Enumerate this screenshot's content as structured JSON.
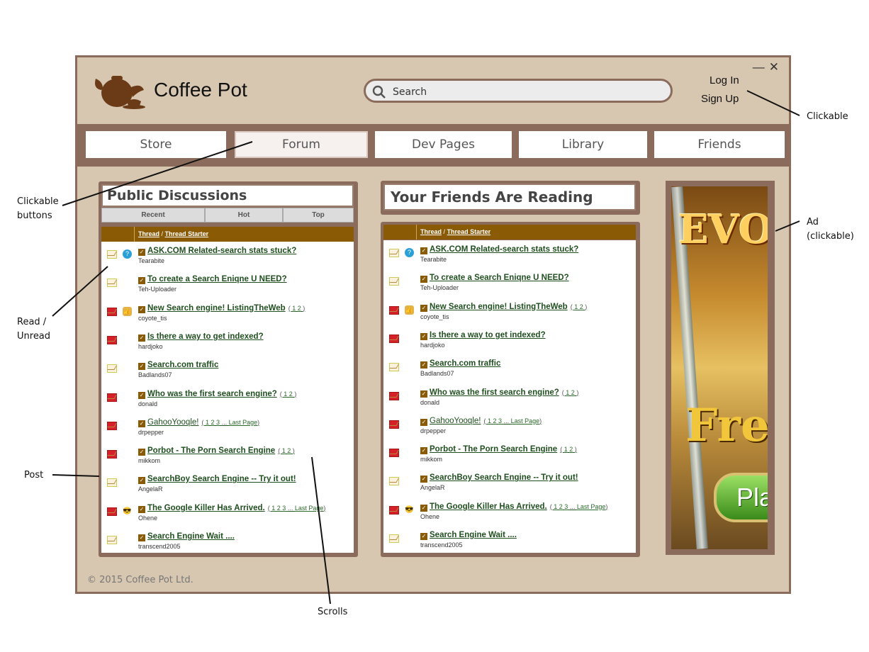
{
  "window": {
    "controls": [
      "—",
      "✕"
    ]
  },
  "header": {
    "brand": "Coffee Pot",
    "logo_icon": "teapot-icon",
    "search_placeholder": "Search",
    "login_label": "Log In",
    "signup_label": "Sign Up"
  },
  "nav": {
    "tabs": [
      {
        "label": "Store"
      },
      {
        "label": "Forum"
      },
      {
        "label": "Dev Pages"
      },
      {
        "label": "Library"
      },
      {
        "label": "Friends"
      }
    ],
    "active": "Forum"
  },
  "public_discussions": {
    "heading": "Public Discussions",
    "subtabs": [
      "Recent",
      "Hot",
      "Top"
    ],
    "col_thread": "Thread",
    "col_separator": "/",
    "col_starter": "Thread Starter"
  },
  "friends_reading": {
    "heading": "Your Friends Are Reading",
    "col_thread": "Thread",
    "col_separator": "/",
    "col_starter": "Thread Starter"
  },
  "threads": [
    {
      "title": "ASK.COM Related-search stats stuck?",
      "starter": "Tearabite",
      "unread": false,
      "badge": "question"
    },
    {
      "title": "To create a Search Eniqne U NEED?",
      "starter": "Teh-Uploader",
      "unread": false,
      "badge": ""
    },
    {
      "title": "New Search engine! ListingTheWeb",
      "starter": "coyote_tis",
      "unread": true,
      "badge": "thumbs-up",
      "pages": [
        "1",
        "2"
      ]
    },
    {
      "title": "Is there a way to get indexed?",
      "starter": "hardjoko",
      "unread": true,
      "badge": ""
    },
    {
      "title": "Search.com traffic",
      "starter": "Badlands07",
      "unread": false,
      "badge": ""
    },
    {
      "title": "Who was the first search engine?",
      "starter": "donald",
      "unread": true,
      "badge": "",
      "pages": [
        "1",
        "2"
      ]
    },
    {
      "title": "GahooYooqle!",
      "starter": "drpepper",
      "unread": true,
      "badge": "",
      "pages": [
        "1",
        "2",
        "3"
      ],
      "last_page": "Last Page",
      "normal": true
    },
    {
      "title": "Porbot - The Porn Search Engine",
      "starter": "mikkom",
      "unread": true,
      "badge": "",
      "pages": [
        "1",
        "2"
      ]
    },
    {
      "title": "SearchBoy Search Engine -- Try it out!",
      "starter": "AngelaR",
      "unread": false,
      "badge": ""
    },
    {
      "title": "The Google Killer Has Arrived.",
      "starter": "Ohene",
      "unread": true,
      "badge": "sunglasses",
      "pages": [
        "1",
        "2",
        "3"
      ],
      "last_page": "Last Page"
    },
    {
      "title": "Search Engine Wait ....",
      "starter": "transcend2005",
      "unread": false,
      "badge": ""
    }
  ],
  "ad": {
    "text_top": "EVON",
    "text_mid": "Free F",
    "button": "Play"
  },
  "footer": {
    "copyright": "© 2015 Coffee Pot Ltd."
  },
  "callouts": {
    "clickable": "Clickable",
    "clickable_buttons": [
      "Clickable",
      "buttons"
    ],
    "read_unread": [
      "Read /",
      "Unread"
    ],
    "post": "Post",
    "scrolls": "Scrolls",
    "ad": [
      "Ad",
      "(clickable)"
    ]
  }
}
